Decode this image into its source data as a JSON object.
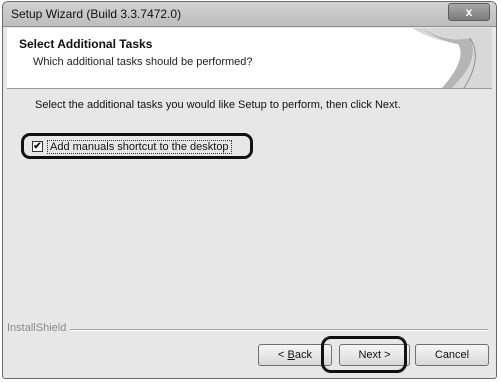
{
  "window": {
    "title": "Setup Wizard (Build 3.3.7472.0)",
    "close_glyph": "x"
  },
  "header": {
    "title": "Select Additional Tasks",
    "subtitle": "Which additional tasks should be performed?",
    "art_icon": "curled-page-art"
  },
  "content": {
    "instructions": "Select the additional tasks you would like Setup to perform, then click Next.",
    "task": {
      "label": "Add manuals shortcut to the desktop",
      "checked": true,
      "check_glyph": "✔"
    }
  },
  "footer": {
    "brand": "InstallShield",
    "back_label_underlined": "B",
    "back_label_rest": "ack",
    "back_prefix": "< ",
    "next_label": "Next >",
    "cancel_label": "Cancel"
  }
}
